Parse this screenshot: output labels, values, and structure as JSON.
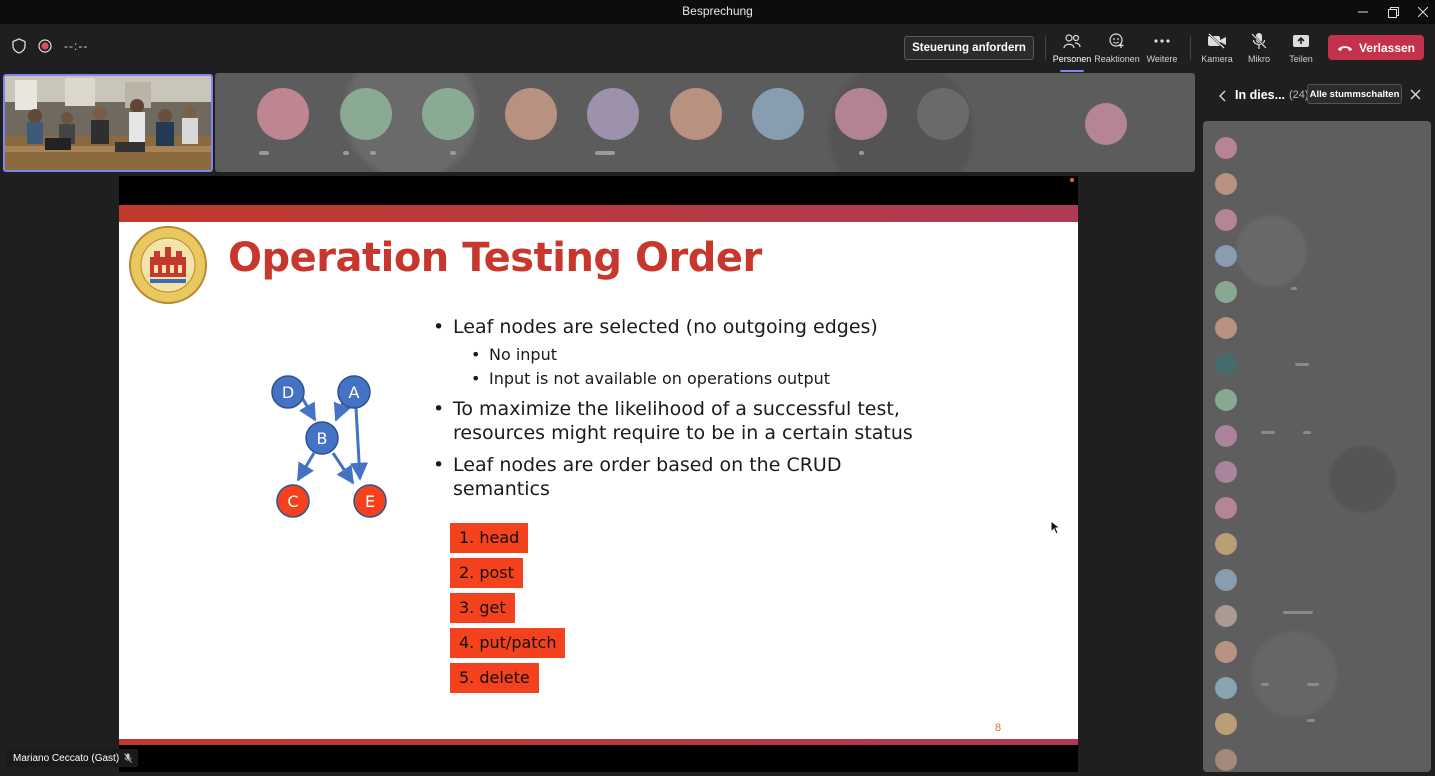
{
  "window": {
    "title": "Besprechung"
  },
  "toolbar": {
    "timer": "--:--",
    "control_request": "Steuerung anfordern",
    "items": [
      {
        "label": "Personen",
        "icon": "people-icon"
      },
      {
        "label": "Reaktionen",
        "icon": "reactions-icon"
      },
      {
        "label": "Weitere",
        "icon": "more-icon"
      },
      {
        "label": "Kamera",
        "icon": "camera-off-icon"
      },
      {
        "label": "Mikro",
        "icon": "mic-off-icon"
      },
      {
        "label": "Teilen",
        "icon": "share-icon"
      }
    ],
    "leave": "Verlassen",
    "leave_color": "#c4314b",
    "accent": "#7f85f5"
  },
  "slide": {
    "title": "Operation Testing Order",
    "bullets": [
      "Leaf nodes are selected (no outgoing edges)",
      "To maximize the likelihood of a successful test, resources might require to be in a certain status",
      "Leaf nodes are order based on the CRUD semantics"
    ],
    "sub_bullets": [
      "No input",
      "Input is not available on operations output"
    ],
    "crud_order": [
      "1. head",
      "2. post",
      "3. get",
      "4. put/patch",
      "5. delete"
    ],
    "graph_nodes": [
      "D",
      "A",
      "B",
      "C",
      "E"
    ],
    "page_number": "8",
    "title_color": "#c8372d",
    "node_blue": "#4472c4",
    "node_red": "#f4411e"
  },
  "panel": {
    "title": "In dies...",
    "count": "(24)",
    "mute_all": "Alle stummschalten"
  },
  "presenter": {
    "name": "Mariano Ceccato (Gast)"
  }
}
